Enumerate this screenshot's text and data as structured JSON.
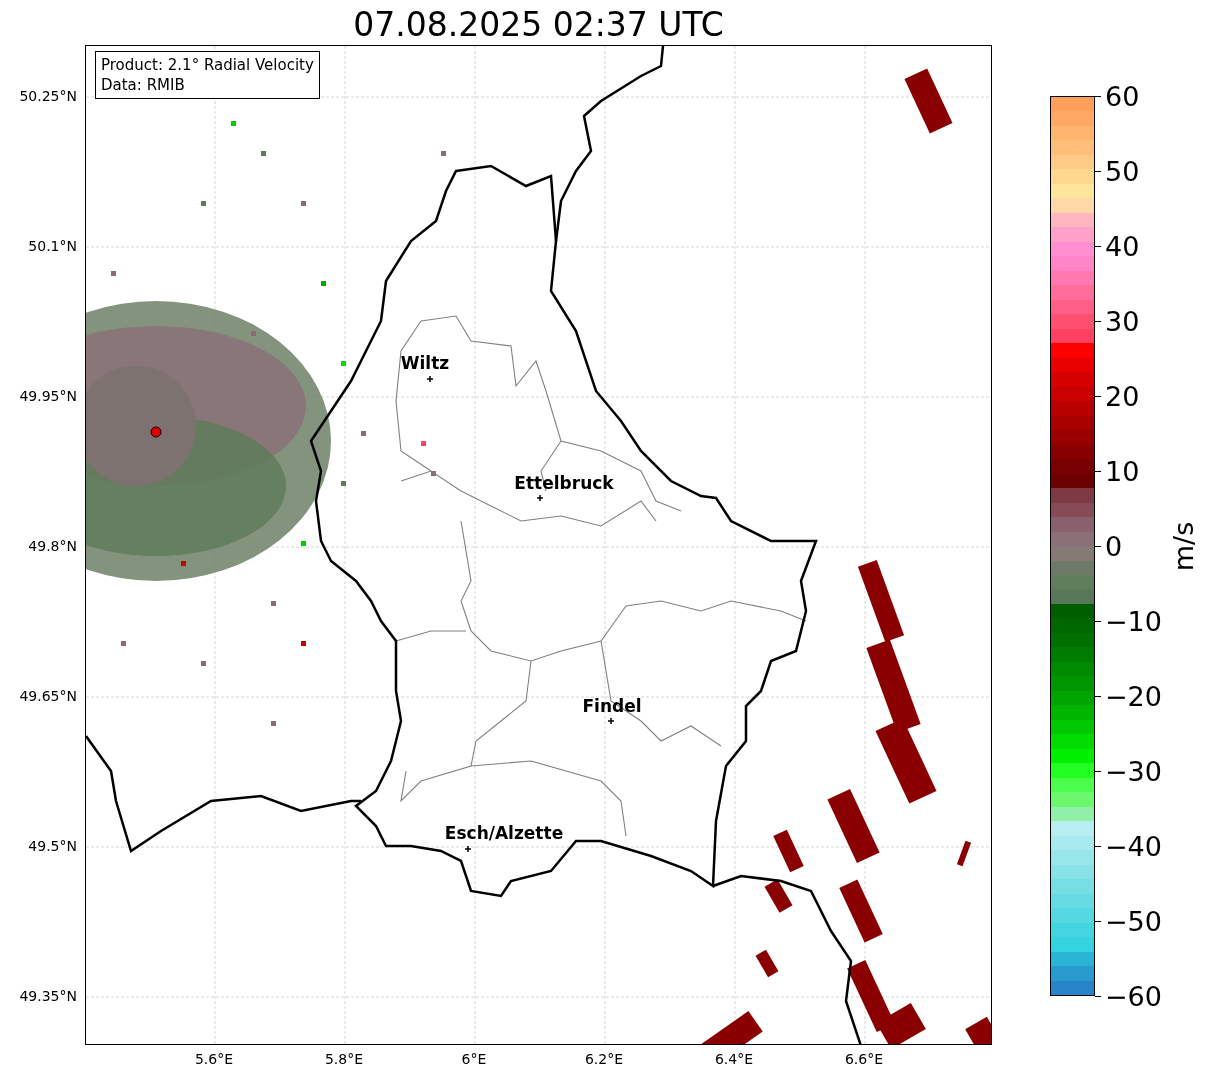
{
  "title": "07.08.2025 02:37 UTC",
  "info_box": {
    "lines": [
      "Product: 2.1° Radial Velocity",
      "Data: RMIB"
    ]
  },
  "map": {
    "cities": [
      {
        "name": "Wiltz"
      },
      {
        "name": "Ettelbruck"
      },
      {
        "name": "Findel"
      },
      {
        "name": "Esch/Alzette"
      }
    ]
  },
  "y_axis": {
    "ticks": [
      "50.25°N",
      "50.1°N",
      "49.95°N",
      "49.8°N",
      "49.65°N",
      "49.5°N",
      "49.35°N"
    ]
  },
  "x_axis": {
    "ticks": [
      "5.6°E",
      "5.8°E",
      "6°E",
      "6.2°E",
      "6.4°E",
      "6.6°E"
    ]
  },
  "colorbar": {
    "label": "m/s",
    "ticks": [
      "60",
      "50",
      "40",
      "30",
      "20",
      "10",
      "0",
      "−10",
      "−20",
      "−30",
      "−40",
      "−50",
      "−60"
    ]
  }
}
